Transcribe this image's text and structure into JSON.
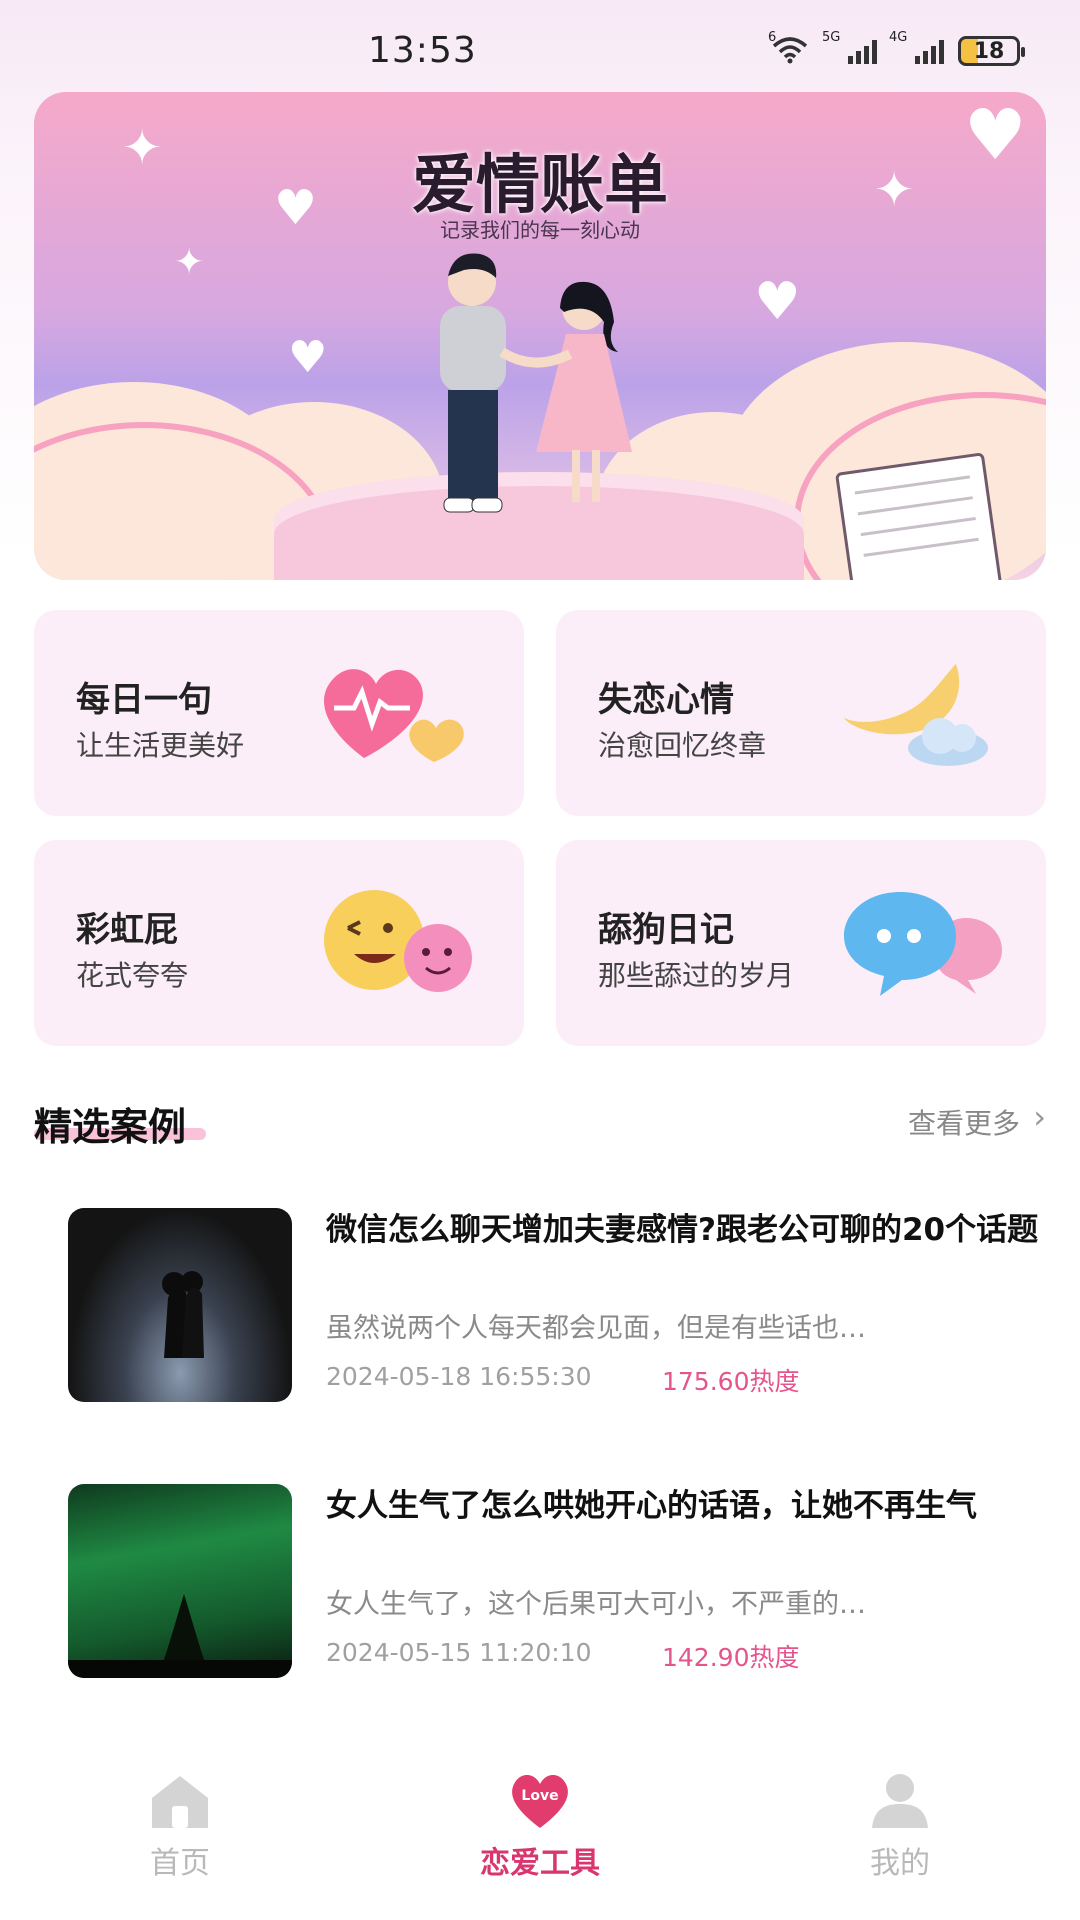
{
  "status_bar": {
    "time": "13:53",
    "wifi_tag": "6",
    "sig1_tag": "5G",
    "sig2_tag": "4G",
    "battery": "18"
  },
  "banner": {
    "title": "爱情账单",
    "subtitle": "记录我们的每一刻心动"
  },
  "tools": [
    {
      "title": "每日一句",
      "subtitle": "让生活更美好",
      "icon": "heartbeat-heart-icon"
    },
    {
      "title": "失恋心情",
      "subtitle": "治愈回忆终章",
      "icon": "moon-cloud-icon"
    },
    {
      "title": "彩虹屁",
      "subtitle": "花式夸夸",
      "icon": "emoji-faces-icon"
    },
    {
      "title": "舔狗日记",
      "subtitle": "那些舔过的岁月",
      "icon": "chat-bubbles-icon"
    }
  ],
  "section": {
    "title": "精选案例",
    "more": "查看更多"
  },
  "articles": [
    {
      "title": "微信怎么聊天增加夫妻感情?跟老公可聊的20个话题",
      "desc": "虽然说两个人每天都会见面，但是有些话也…",
      "date": "2024-05-18 16:55:30",
      "heat": "175.60热度"
    },
    {
      "title": "女人生气了怎么哄她开心的话语，让她不再生气",
      "desc": "女人生气了，这个后果可大可小，不严重的…",
      "date": "2024-05-15 11:20:10",
      "heat": "142.90热度"
    }
  ],
  "tabbar": {
    "home": "首页",
    "love_tools": "恋爱工具",
    "love_badge": "Love",
    "mine": "我的"
  },
  "colors": {
    "accent": "#d9356f",
    "heat": "#e3558c",
    "card_bg": "#fbeef8"
  }
}
